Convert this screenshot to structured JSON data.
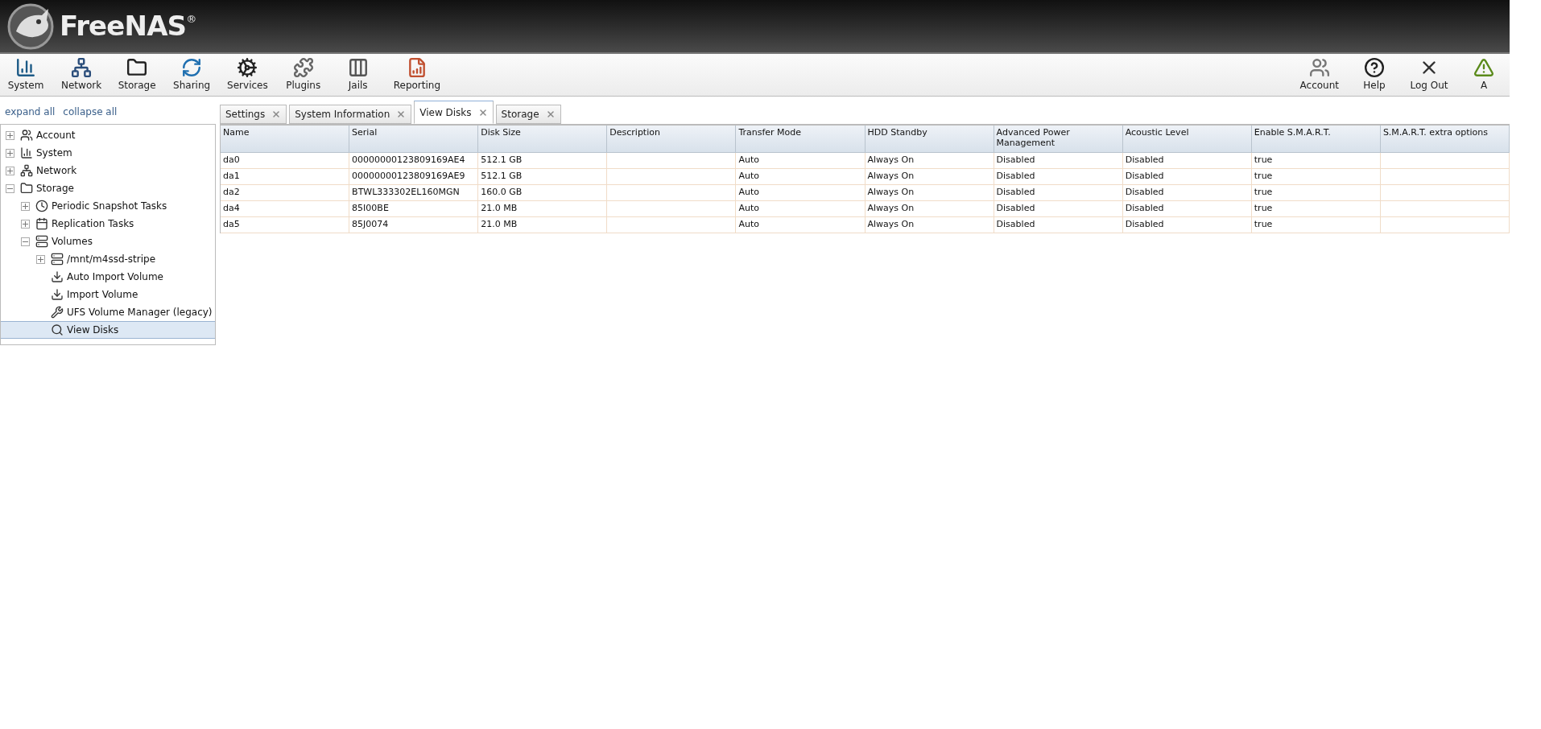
{
  "brand": {
    "name": "FreeNAS",
    "mark": "®"
  },
  "toolbar": {
    "left": [
      {
        "kind": "system",
        "label": "System"
      },
      {
        "kind": "network",
        "label": "Network"
      },
      {
        "kind": "storage",
        "label": "Storage"
      },
      {
        "kind": "sharing",
        "label": "Sharing"
      },
      {
        "kind": "services",
        "label": "Services"
      },
      {
        "kind": "plugins",
        "label": "Plugins"
      },
      {
        "kind": "jails",
        "label": "Jails"
      },
      {
        "kind": "reporting",
        "label": "Reporting"
      }
    ],
    "right": [
      {
        "kind": "account",
        "label": "Account"
      },
      {
        "kind": "help",
        "label": "Help"
      },
      {
        "kind": "logout",
        "label": "Log Out"
      },
      {
        "kind": "alert",
        "label": "A"
      }
    ]
  },
  "sidebar": {
    "links": [
      "expand all",
      "collapse all"
    ],
    "tree": [
      {
        "kind": "account",
        "label": "Account",
        "expanded": false,
        "selected": false
      },
      {
        "kind": "system",
        "label": "System",
        "expanded": false,
        "selected": false
      },
      {
        "kind": "network",
        "label": "Network",
        "expanded": false,
        "selected": false
      },
      {
        "kind": "storage",
        "label": "Storage",
        "expanded": true,
        "selected": false,
        "children": [
          {
            "kind": "snapshot",
            "label": "Periodic Snapshot Tasks",
            "expanded": false,
            "selected": false
          },
          {
            "kind": "replication",
            "label": "Replication Tasks",
            "expanded": false,
            "selected": false
          },
          {
            "kind": "volume",
            "label": "Volumes",
            "expanded": true,
            "selected": false,
            "children": [
              {
                "kind": "volume",
                "label": "/mnt/m4ssd-stripe",
                "expanded": false,
                "selected": false
              },
              {
                "kind": "import",
                "label": "Auto Import Volume",
                "selected": false
              },
              {
                "kind": "import",
                "label": "Import Volume",
                "selected": false
              },
              {
                "kind": "manager",
                "label": "UFS Volume Manager (legacy)",
                "selected": false
              },
              {
                "kind": "view",
                "label": "View Disks",
                "selected": true
              }
            ]
          }
        ]
      }
    ]
  },
  "tabs": [
    {
      "label": "Settings",
      "selected": false
    },
    {
      "label": "System Information",
      "selected": false
    },
    {
      "label": "View Disks",
      "selected": true
    },
    {
      "label": "Storage",
      "selected": false
    }
  ],
  "table": {
    "columns": [
      "Name",
      "Serial",
      "Disk Size",
      "Description",
      "Transfer Mode",
      "HDD Standby",
      "Advanced Power Management",
      "Acoustic Level",
      "Enable S.M.A.R.T.",
      "S.M.A.R.T. extra options"
    ],
    "rows": [
      [
        "da0",
        "00000000123809169AE4",
        "512.1 GB",
        "",
        "Auto",
        "Always On",
        "Disabled",
        "Disabled",
        "true",
        ""
      ],
      [
        "da1",
        "00000000123809169AE9",
        "512.1 GB",
        "",
        "Auto",
        "Always On",
        "Disabled",
        "Disabled",
        "true",
        ""
      ],
      [
        "da2",
        "BTWL333302EL160MGN",
        "160.0 GB",
        "",
        "Auto",
        "Always On",
        "Disabled",
        "Disabled",
        "true",
        ""
      ],
      [
        "da4",
        "85I00BE",
        "21.0 MB",
        "",
        "Auto",
        "Always On",
        "Disabled",
        "Disabled",
        "true",
        ""
      ],
      [
        "da5",
        "85J0074",
        "21.0 MB",
        "",
        "Auto",
        "Always On",
        "Disabled",
        "Disabled",
        "true",
        ""
      ]
    ]
  }
}
